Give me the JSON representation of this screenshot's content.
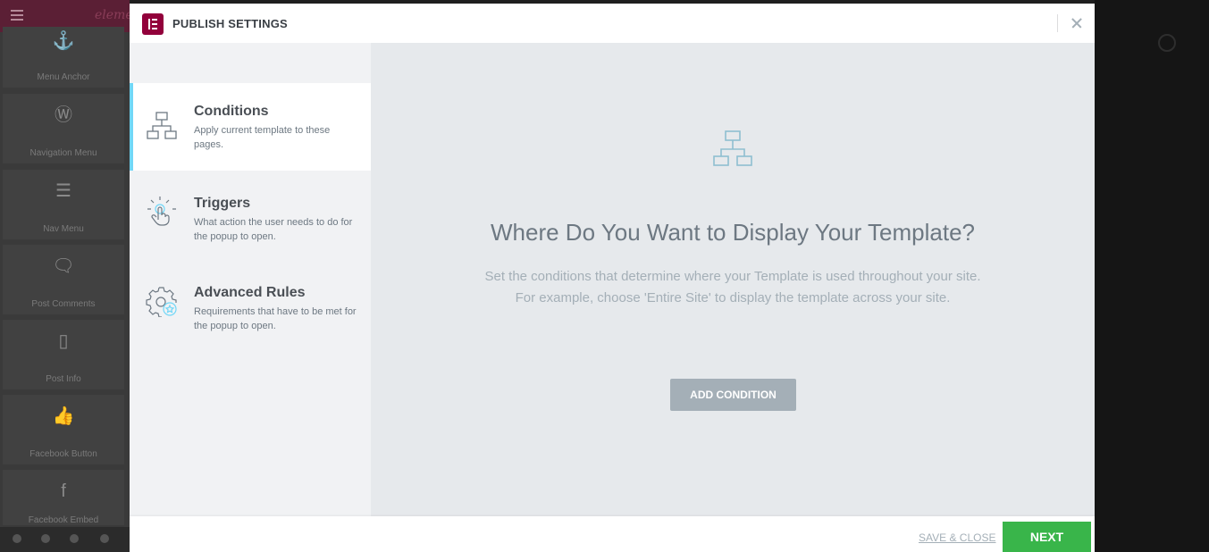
{
  "background_editor": {
    "brand": "eleme",
    "widgets": [
      {
        "label": "Menu Anchor",
        "icon": "anchor-icon",
        "glyph": "⚓"
      },
      {
        "label": "Navigation Menu",
        "icon": "wordpress-icon",
        "glyph": "Ⓦ"
      },
      {
        "label": "Nav Menu",
        "icon": "nav-menu-icon",
        "glyph": "☰"
      },
      {
        "label": "Post Comments",
        "icon": "comments-icon",
        "glyph": "🗨"
      },
      {
        "label": "Post Info",
        "icon": "post-info-icon",
        "glyph": "▯"
      },
      {
        "label": "Facebook Button",
        "icon": "facebook-like-icon",
        "glyph": "👍"
      },
      {
        "label": "Facebook Embed",
        "icon": "facebook-embed-icon",
        "glyph": "f"
      }
    ]
  },
  "modal": {
    "title": "PUBLISH SETTINGS",
    "tabs": [
      {
        "title": "Conditions",
        "desc": "Apply current template to these pages.",
        "icon": "sitemap-icon",
        "active": true
      },
      {
        "title": "Triggers",
        "desc": "What action the user needs to do for the popup to open.",
        "icon": "pointer-click-icon",
        "active": false
      },
      {
        "title": "Advanced Rules",
        "desc": "Requirements that have to be met for the popup to open.",
        "icon": "gear-star-icon",
        "active": false
      }
    ],
    "main": {
      "heading": "Where Do You Want to Display Your Template?",
      "desc_line1": "Set the conditions that determine where your Template is used throughout your site.",
      "desc_line2": "For example, choose 'Entire Site' to display the template across your site.",
      "add_button": "ADD CONDITION"
    },
    "footer": {
      "save_close": "SAVE & CLOSE",
      "next": "NEXT"
    }
  },
  "colors": {
    "accent": "#71d7f7",
    "next_green": "#39b54a",
    "brand": "#92003b"
  }
}
